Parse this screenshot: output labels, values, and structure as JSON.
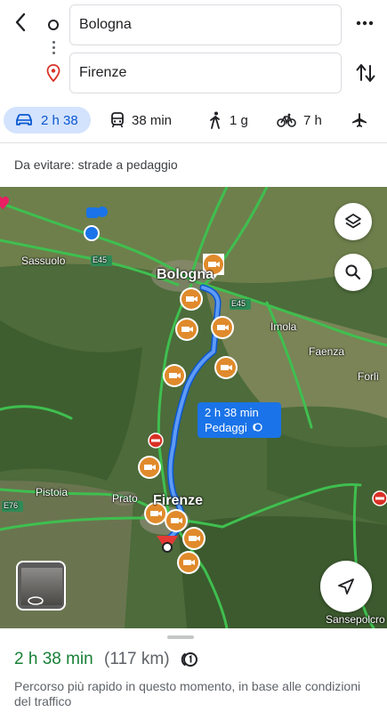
{
  "route": {
    "origin": "Bologna",
    "destination": "Firenze"
  },
  "modes": [
    {
      "name": "car",
      "label": "2 h 38",
      "selected": true
    },
    {
      "name": "transit",
      "label": "38 min"
    },
    {
      "name": "walk",
      "label": "1 g"
    },
    {
      "name": "bike",
      "label": "7 h"
    },
    {
      "name": "flight",
      "label": ""
    }
  ],
  "avoid_text": "Da evitare: strade a pedaggio",
  "map": {
    "cities": {
      "bologna": "Bologna",
      "firenze": "Firenze",
      "sassuolo": "Sassuolo",
      "imola": "Imola",
      "faenza": "Faenza",
      "forli": "Forlì",
      "pistoia": "Pistoia",
      "prato": "Prato",
      "sansepolcro": "Sansepolcro"
    },
    "roads": {
      "e45_west": "E45",
      "e45_east": "E45",
      "e76": "E76"
    },
    "route_bubble": {
      "time": "2 h 38 min",
      "note": "Pedaggi"
    },
    "route_color": "#4285f4",
    "highway_color": "#3fbf4f"
  },
  "summary": {
    "duration": "2 h 38 min",
    "distance": "(117 km)",
    "description": "Percorso più rapido in questo momento, in base alle condizioni del traffico"
  }
}
